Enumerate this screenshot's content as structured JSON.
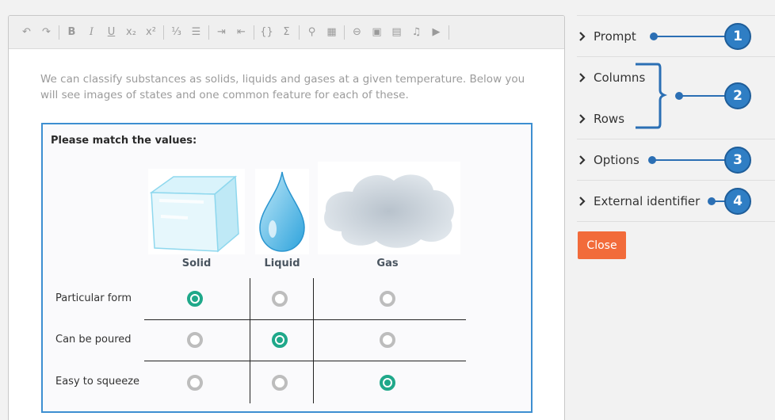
{
  "editor": {
    "toolbar": [
      {
        "name": "undo-icon",
        "glyph": "↶"
      },
      {
        "name": "redo-icon",
        "glyph": "↷"
      },
      {
        "sep": true
      },
      {
        "name": "bold-icon",
        "glyph": "B"
      },
      {
        "name": "italic-icon",
        "glyph": "I"
      },
      {
        "name": "underline-icon",
        "glyph": "U"
      },
      {
        "name": "subscript-icon",
        "glyph": "x₂"
      },
      {
        "name": "superscript-icon",
        "glyph": "x²"
      },
      {
        "sep": true
      },
      {
        "name": "ordered-list-icon",
        "glyph": "⅓"
      },
      {
        "name": "bullet-list-icon",
        "glyph": "☰"
      },
      {
        "sep": true
      },
      {
        "name": "indent-icon",
        "glyph": "⇥"
      },
      {
        "name": "outdent-icon",
        "glyph": "⇤"
      },
      {
        "sep": true
      },
      {
        "name": "code-icon",
        "glyph": "{}"
      },
      {
        "name": "sigma-icon",
        "glyph": "Σ"
      },
      {
        "sep": true
      },
      {
        "name": "attachment-icon",
        "glyph": "⚲"
      },
      {
        "name": "table-icon",
        "glyph": "▦"
      },
      {
        "sep": true
      },
      {
        "name": "link-icon",
        "glyph": "⊖"
      },
      {
        "name": "image-icon",
        "glyph": "▣"
      },
      {
        "name": "pdf-icon",
        "glyph": "▤"
      },
      {
        "name": "audio-icon",
        "glyph": "♫"
      },
      {
        "name": "video-icon",
        "glyph": "▶"
      },
      {
        "sep": true
      }
    ],
    "intro_text": "We can classify substances as solids, liquids and gases at a given temperature. Below you will see images of states and one common feature for each of these."
  },
  "question": {
    "prompt": "Please match the values:",
    "columns": [
      "Solid",
      "Liquid",
      "Gas"
    ],
    "rows": [
      {
        "label": "Particular form",
        "selected": 0
      },
      {
        "label": "Can be poured",
        "selected": 1
      },
      {
        "label": "Easy to squeeze",
        "selected": 2
      }
    ]
  },
  "sidebar": {
    "items": [
      {
        "label": "Prompt",
        "badge": "1"
      },
      {
        "label": "Columns",
        "badge": "2"
      },
      {
        "label": "Rows",
        "badge": "2"
      },
      {
        "label": "Options",
        "badge": "3"
      },
      {
        "label": "External identifier",
        "badge": "4"
      }
    ],
    "close_label": "Close"
  },
  "colors": {
    "accent": "#3d8fd1",
    "selected": "#1fa88a",
    "close_button": "#f26b3a",
    "callout": "#2f7ec4"
  }
}
